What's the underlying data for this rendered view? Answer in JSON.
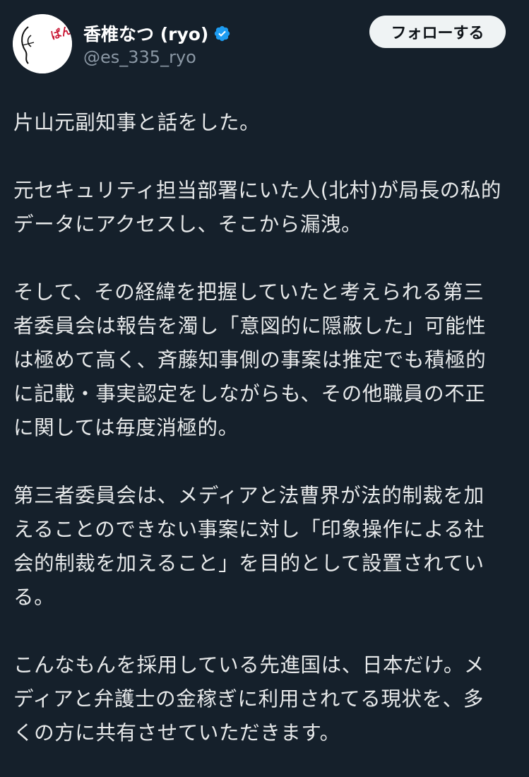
{
  "author": {
    "display_name": "香椎なつ (ryo)",
    "handle": "@es_335_ryo",
    "verified_icon": "verified-badge-icon",
    "avatar_text": "ぱんぱん~"
  },
  "actions": {
    "follow_label": "フォローする"
  },
  "colors": {
    "background": "#15202b",
    "text": "#e7e9ea",
    "secondary_text": "#8b98a5",
    "verified": "#1d9bf0",
    "button_bg": "#eff3f4",
    "avatar_text": "#c8102e"
  },
  "post": {
    "paragraphs": [
      "片山元副知事と話をした。",
      "元セキュリティ担当部署にいた人(北村)が局長の私的\nデータにアクセスし、そこから漏洩。",
      "そして、その経緯を把握していたと考えられる第三\n者委員会は報告を濁し「意図的に隠蔽した」可能性\nは極めて高く、斉藤知事側の事案は推定でも積極的\nに記載・事実認定をしながらも、その他職員の不正\nに関しては毎度消極的。",
      "第三者委員会は、メディアと法曹界が法的制裁を加\nえることのできない事案に対し「印象操作による社\n会的制裁を加えること」を目的として設置されてい\nる。",
      "こんなもんを採用している先進国は、日本だけ。メ\nディアと弁護士の金稼ぎに利用されてる現状を、多\nくの方に共有させていただきます。"
    ]
  }
}
